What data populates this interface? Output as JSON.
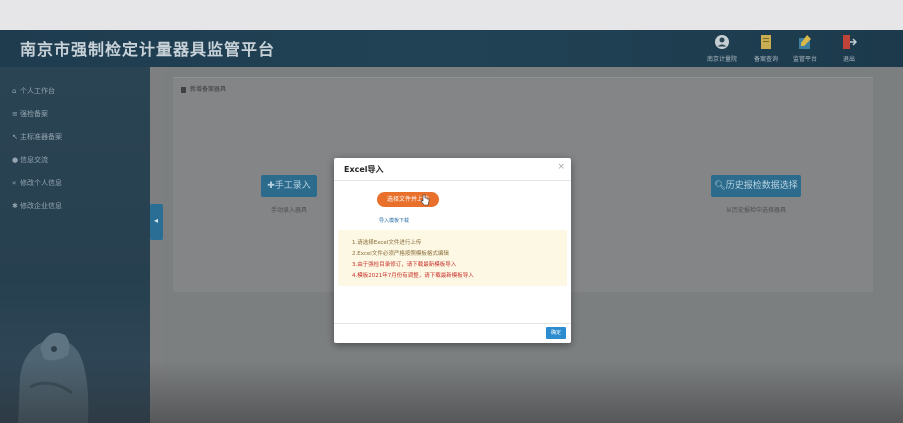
{
  "app": {
    "title": "南京市强制检定计量器具监管平台"
  },
  "header": {
    "items": [
      {
        "label": "南京计量院",
        "icon": "user-circle-icon"
      },
      {
        "label": "备案查询",
        "icon": "document-icon"
      },
      {
        "label": "监管平台",
        "icon": "pencil-icon"
      },
      {
        "label": "退出",
        "icon": "exit-icon"
      }
    ]
  },
  "sidebar": {
    "items": [
      {
        "label": "个人工作台",
        "icon": "home-icon"
      },
      {
        "label": "强检备案",
        "icon": "list-icon"
      },
      {
        "label": "主标准器备案",
        "icon": "wrench-icon"
      },
      {
        "label": "信息交流",
        "icon": "chat-icon"
      },
      {
        "label": "修改个人信息",
        "icon": "edit-icon"
      },
      {
        "label": "修改企业信息",
        "icon": "gear-icon"
      }
    ]
  },
  "panel": {
    "heading": "新增备案器具",
    "manual": {
      "button": "手工录入",
      "sub": "手动录入器具"
    },
    "history": {
      "button": "历史报检数据选择",
      "sub": "从历史报检中选择器具"
    }
  },
  "modal": {
    "title": "Excel导入",
    "close": "×",
    "select_button": "选择文件并上传",
    "template_link": "导入模板下载",
    "notices": [
      "1.请选择Excel文件进行上传",
      "2.Excel文件必须严格按照模板格式编辑",
      "3.由于强检目录修订，请下载最新模板导入",
      "4.模板2021年7月份有调整，请下载最新模板导入"
    ],
    "confirm": "确定"
  },
  "colors": {
    "header_bg": "#214255",
    "select_button": "#e8702a",
    "confirm_button": "#2d8ccf",
    "notice_bg": "#fcf8e3",
    "notice_text": "#8a6d3b",
    "notice_warn": "#c9302c"
  }
}
